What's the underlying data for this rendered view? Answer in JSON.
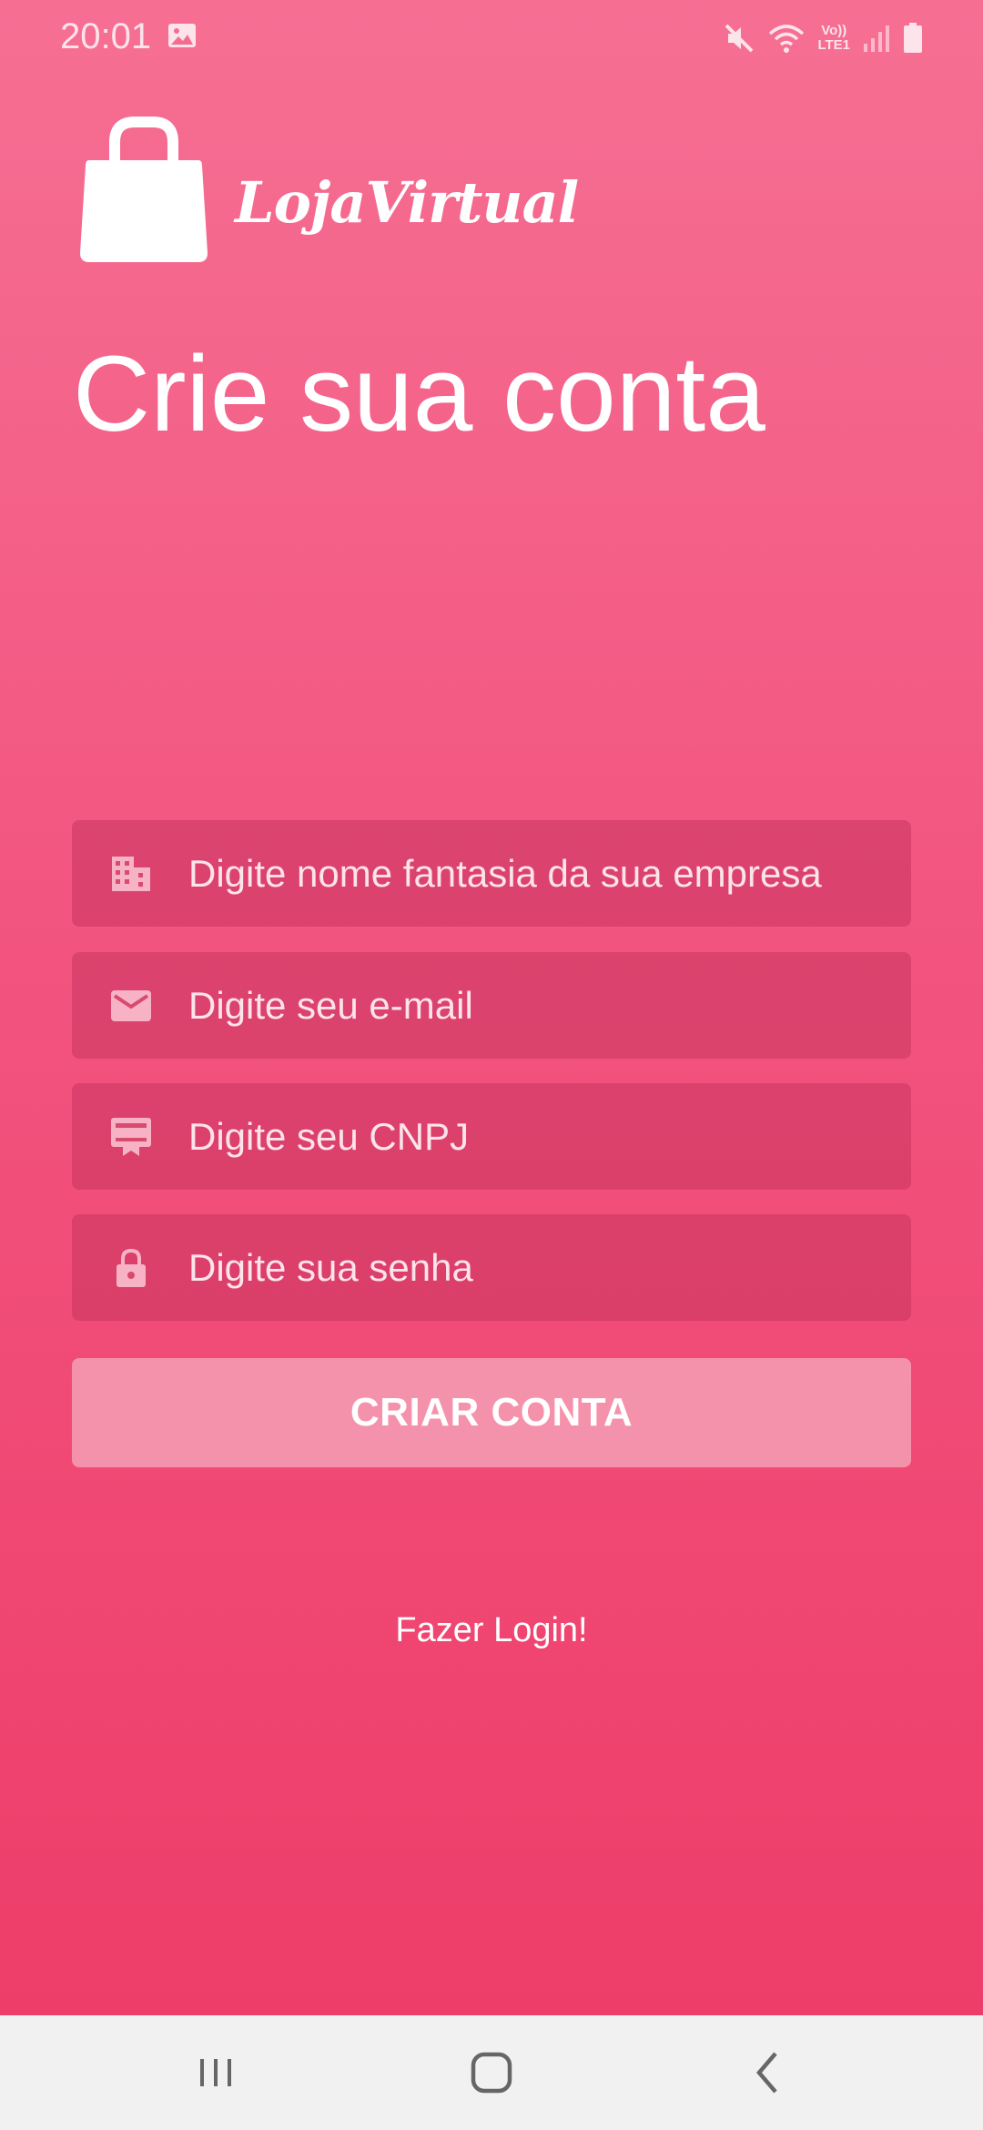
{
  "status_bar": {
    "time": "20:01",
    "network_top": "Vo))",
    "network_bottom": "LTE1",
    "icons": [
      "gallery-icon",
      "mute-icon",
      "wifi-icon",
      "signal-icon",
      "battery-icon"
    ]
  },
  "brand": {
    "logo_icon": "shopping-bag-icon",
    "name": "LojaVirtual"
  },
  "page": {
    "title": "Crie sua conta"
  },
  "form": {
    "company_name": {
      "placeholder": "Digite nome fantasia da sua empresa",
      "value": "",
      "icon": "building-icon"
    },
    "email": {
      "placeholder": "Digite seu e-mail",
      "value": "",
      "icon": "mail-icon"
    },
    "cnpj": {
      "placeholder": "Digite seu CNPJ",
      "value": "",
      "icon": "card-membership-icon"
    },
    "password": {
      "placeholder": "Digite sua senha",
      "value": "",
      "icon": "lock-icon"
    },
    "submit_label": "CRIAR CONTA"
  },
  "login_link": "Fazer Login!",
  "nav_bar": {
    "buttons": [
      "recent-apps-icon",
      "home-icon",
      "back-icon"
    ]
  },
  "colors": {
    "gradient_top": "#f66f93",
    "gradient_bottom": "#ee3d69",
    "field_bg": "#d84a6e",
    "button_bg": "#f592ab",
    "text": "#ffffff"
  }
}
